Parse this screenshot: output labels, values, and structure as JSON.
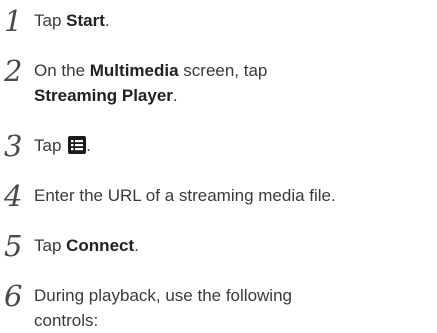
{
  "steps": [
    {
      "num": "1",
      "pre": "Tap ",
      "bold": "Start",
      "post": "."
    },
    {
      "num": "2",
      "pre": "On the ",
      "bold": "Multimedia",
      "mid": " screen, tap",
      "bold2": "Streaming Player",
      "post": "."
    },
    {
      "num": "3",
      "pre": "Tap ",
      "icon": "menu-list-icon",
      "post": "."
    },
    {
      "num": "4",
      "text": "Enter the URL of a streaming media file."
    },
    {
      "num": "5",
      "pre": "Tap ",
      "bold": "Connect",
      "post": "."
    },
    {
      "num": "6",
      "line1": "During playback, use the following",
      "line2": "controls:"
    }
  ]
}
